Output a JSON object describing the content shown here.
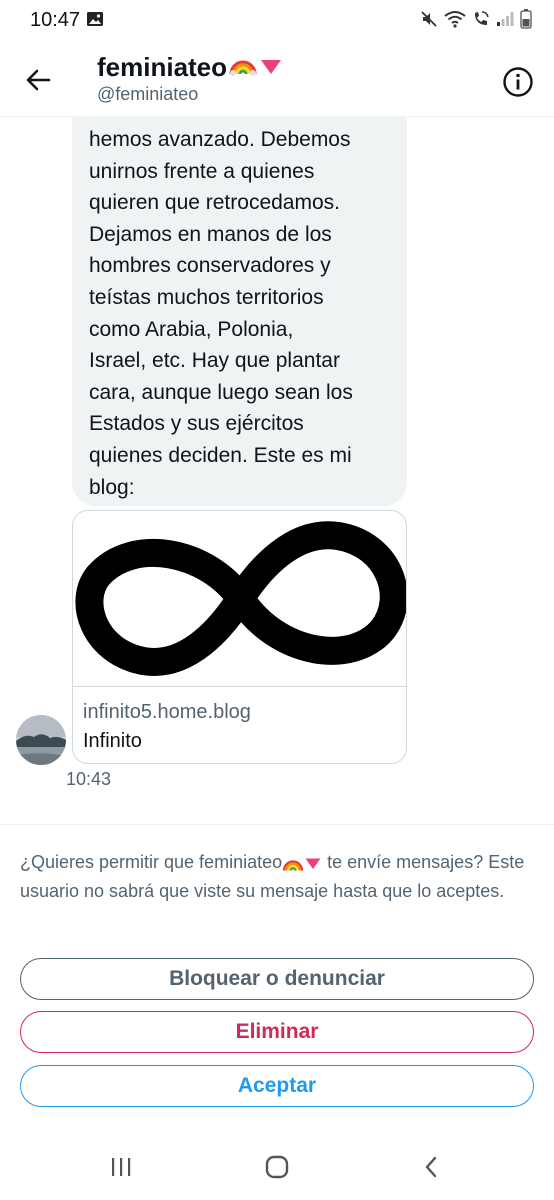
{
  "status_bar": {
    "time": "10:47",
    "icons_left": [
      "image-icon"
    ],
    "icons_right": [
      "mute-icon",
      "wifi-icon",
      "wifi-call-icon",
      "signal-icon",
      "battery-icon"
    ]
  },
  "header": {
    "name": "feminiateo",
    "handle": "@feminiateo",
    "back_icon": "arrow-left-icon",
    "info_icon": "info-icon"
  },
  "message": {
    "text": "hemos avanzado. Debemos\nunirnos frente a quienes\nquieren que retrocedamos.\nDejamos en manos de los\nhombres conservadores y\nteístas muchos territorios\ncomo Arabia, Polonia,\nIsrael, etc. Hay que plantar\ncara, aunque luego sean los\nEstados y sus ejércitos\nquienes deciden.  Este es mi\nblog:",
    "card": {
      "domain": "infinito5.home.blog",
      "title": "Infinito",
      "image": "infinity-symbol"
    },
    "timestamp": "10:43"
  },
  "request": {
    "text_before": "¿Quieres permitir que feminiateo",
    "text_after": " te envíe mensajes? Este usuario no sabrá que viste su mensaje hasta que lo aceptes."
  },
  "buttons": {
    "block": "Bloquear o denunciar",
    "delete": "Eliminar",
    "accept": "Aceptar"
  },
  "colors": {
    "primary": "#1d9bf0",
    "danger": "#d02a5a",
    "secondary": "#536471",
    "bubble": "#eff3f4"
  },
  "nav": {
    "items": [
      "recents-icon",
      "home-icon",
      "back-icon"
    ]
  }
}
